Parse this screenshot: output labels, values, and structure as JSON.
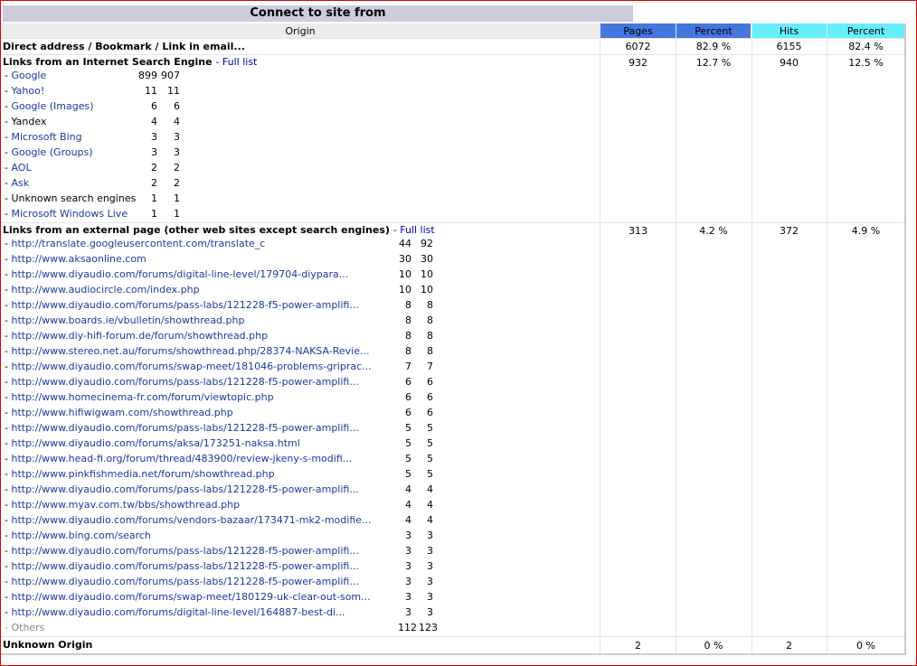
{
  "title": "Connect to site from",
  "headers": {
    "origin": "Origin",
    "pages": "Pages",
    "pages_percent": "Percent",
    "hits": "Hits",
    "hits_percent": "Percent"
  },
  "colors": {
    "pages_header": "#4477dd",
    "hits_header": "#66eeff",
    "origin_header": "#ececec",
    "title_bar": "#ccccdd",
    "link": "#1a3a9a",
    "frame": "#e00000"
  },
  "direct": {
    "label": "Direct address / Bookmark / Link in email...",
    "pages": "6072",
    "pages_pct": "82.9 %",
    "hits": "6155",
    "hits_pct": "82.4 %"
  },
  "search_engines": {
    "label": "Links from an Internet Search Engine",
    "full_list": "Full list",
    "pages": "932",
    "pages_pct": "12.7 %",
    "hits": "940",
    "hits_pct": "12.5 %",
    "items": [
      {
        "name": "Google",
        "pages": "899",
        "hits": "907",
        "link": true
      },
      {
        "name": "Yahoo!",
        "pages": "11",
        "hits": "11",
        "link": true
      },
      {
        "name": "Google (Images)",
        "pages": "6",
        "hits": "6",
        "link": true
      },
      {
        "name": "Yandex",
        "pages": "4",
        "hits": "4",
        "link": false
      },
      {
        "name": "Microsoft Bing",
        "pages": "3",
        "hits": "3",
        "link": true
      },
      {
        "name": "Google (Groups)",
        "pages": "3",
        "hits": "3",
        "link": true
      },
      {
        "name": "AOL",
        "pages": "2",
        "hits": "2",
        "link": true
      },
      {
        "name": "Ask",
        "pages": "2",
        "hits": "2",
        "link": true
      },
      {
        "name": "Unknown search engines",
        "pages": "1",
        "hits": "1",
        "link": false
      },
      {
        "name": "Microsoft Windows Live",
        "pages": "1",
        "hits": "1",
        "link": true
      }
    ]
  },
  "external": {
    "label": "Links from an external page (other web sites except search engines)",
    "full_list": "Full list",
    "pages": "313",
    "pages_pct": "4.2 %",
    "hits": "372",
    "hits_pct": "4.9 %",
    "items": [
      {
        "url": "http://translate.googleusercontent.com/translate_c",
        "pages": "44",
        "hits": "92"
      },
      {
        "url": "http://www.aksaonline.com",
        "pages": "30",
        "hits": "30"
      },
      {
        "url": "http://www.diyaudio.com/forums/digital-line-level/179704-diypara...",
        "pages": "10",
        "hits": "10"
      },
      {
        "url": "http://www.audiocircle.com/index.php",
        "pages": "10",
        "hits": "10"
      },
      {
        "url": "http://www.diyaudio.com/forums/pass-labs/121228-f5-power-amplifi...",
        "pages": "8",
        "hits": "8"
      },
      {
        "url": "http://www.boards.ie/vbulletin/showthread.php",
        "pages": "8",
        "hits": "8"
      },
      {
        "url": "http://www.diy-hifi-forum.de/forum/showthread.php",
        "pages": "8",
        "hits": "8"
      },
      {
        "url": "http://www.stereo.net.au/forums/showthread.php/28374-NAKSA-Revie...",
        "pages": "8",
        "hits": "8"
      },
      {
        "url": "http://www.diyaudio.com/forums/swap-meet/181046-problems-griprac...",
        "pages": "7",
        "hits": "7"
      },
      {
        "url": "http://www.diyaudio.com/forums/pass-labs/121228-f5-power-amplifi...",
        "pages": "6",
        "hits": "6"
      },
      {
        "url": "http://www.homecinema-fr.com/forum/viewtopic.php",
        "pages": "6",
        "hits": "6"
      },
      {
        "url": "http://www.hifiwigwam.com/showthread.php",
        "pages": "6",
        "hits": "6"
      },
      {
        "url": "http://www.diyaudio.com/forums/pass-labs/121228-f5-power-amplifi...",
        "pages": "5",
        "hits": "5"
      },
      {
        "url": "http://www.diyaudio.com/forums/aksa/173251-naksa.html",
        "pages": "5",
        "hits": "5"
      },
      {
        "url": "http://www.head-fi.org/forum/thread/483900/review-jkeny-s-modifi...",
        "pages": "5",
        "hits": "5"
      },
      {
        "url": "http://www.pinkfishmedia.net/forum/showthread.php",
        "pages": "5",
        "hits": "5"
      },
      {
        "url": "http://www.diyaudio.com/forums/pass-labs/121228-f5-power-amplifi...",
        "pages": "4",
        "hits": "4"
      },
      {
        "url": "http://www.myav.com.tw/bbs/showthread.php",
        "pages": "4",
        "hits": "4"
      },
      {
        "url": "http://www.diyaudio.com/forums/vendors-bazaar/173471-mk2-modifie...",
        "pages": "4",
        "hits": "4"
      },
      {
        "url": "http://www.bing.com/search",
        "pages": "3",
        "hits": "3"
      },
      {
        "url": "http://www.diyaudio.com/forums/pass-labs/121228-f5-power-amplifi...",
        "pages": "3",
        "hits": "3"
      },
      {
        "url": "http://www.diyaudio.com/forums/pass-labs/121228-f5-power-amplifi...",
        "pages": "3",
        "hits": "3"
      },
      {
        "url": "http://www.diyaudio.com/forums/pass-labs/121228-f5-power-amplifi...",
        "pages": "3",
        "hits": "3"
      },
      {
        "url": "http://www.diyaudio.com/forums/swap-meet/180129-uk-clear-out-som...",
        "pages": "3",
        "hits": "3"
      },
      {
        "url": "http://www.diyaudio.com/forums/digital-line-level/164887-best-di...",
        "pages": "3",
        "hits": "3"
      }
    ],
    "others": {
      "label": "Others",
      "pages": "112",
      "hits": "123"
    }
  },
  "unknown": {
    "label": "Unknown Origin",
    "pages": "2",
    "pages_pct": "0 %",
    "hits": "2",
    "hits_pct": "0 %"
  }
}
